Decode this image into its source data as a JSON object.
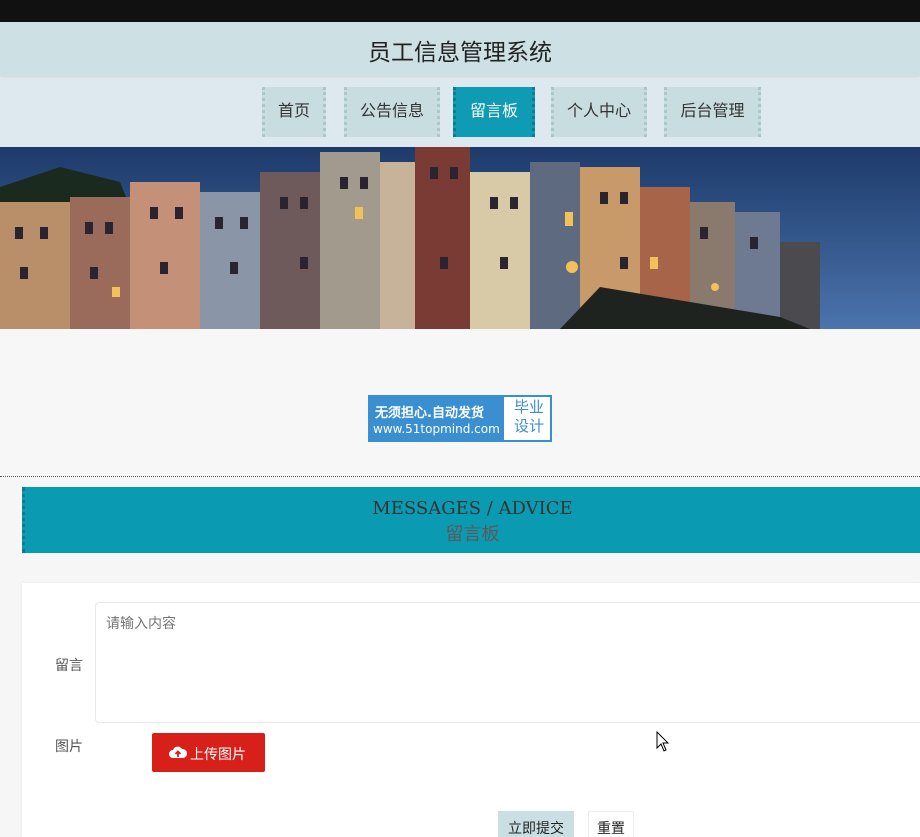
{
  "header": {
    "title": "员工信息管理系统"
  },
  "nav": {
    "items": [
      {
        "label": "首页"
      },
      {
        "label": "公告信息"
      },
      {
        "label": "留言板"
      },
      {
        "label": "个人中心"
      },
      {
        "label": "后台管理"
      }
    ],
    "active_index": 2
  },
  "ad": {
    "line1": "无须担心.自动发货",
    "line2": "www.51topmind.com",
    "badge_line1": "毕业",
    "badge_line2": "设计"
  },
  "section": {
    "title_en": "MESSAGES / ADVICE",
    "title_cn": "留言板"
  },
  "form": {
    "message_label": "留言",
    "message_placeholder": "请输入内容",
    "image_label": "图片",
    "upload_label": "上传图片",
    "submit_label": "立即提交",
    "reset_label": "重置"
  },
  "colors": {
    "accent": "#0e9bb3",
    "upload": "#d8201a",
    "title_bar": "#cde0e3"
  }
}
